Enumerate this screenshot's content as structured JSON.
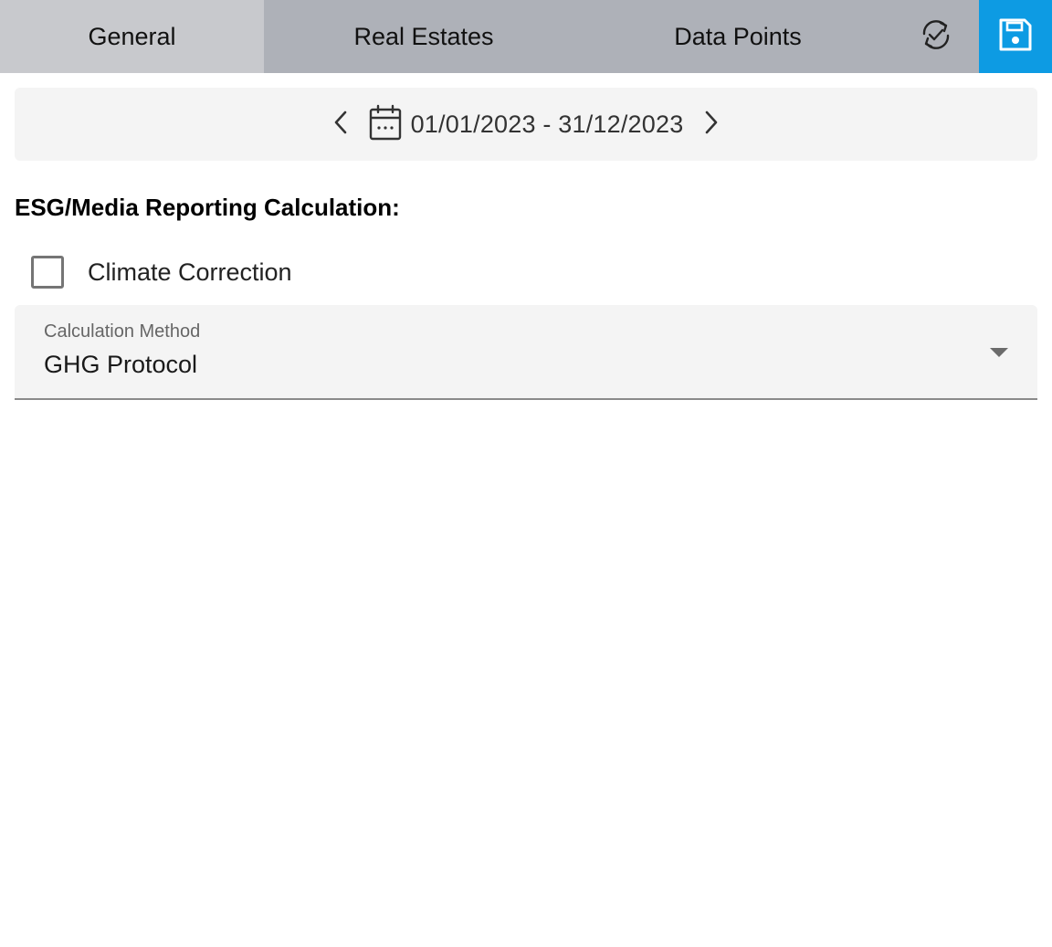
{
  "tabs": {
    "general": "General",
    "real_estates": "Real Estates",
    "data_points": "Data Points"
  },
  "toolbar": {
    "sync_icon": "sync-check-icon",
    "save_icon": "save-icon",
    "save_color": "#0d9be3"
  },
  "date_range": {
    "value": "01/01/2023 - 31/12/2023",
    "prev_icon": "chevron-left-icon",
    "next_icon": "chevron-right-icon",
    "calendar_icon": "calendar-icon"
  },
  "section": {
    "title": "ESG/Media Reporting Calculation:"
  },
  "climate_correction": {
    "label": "Climate Correction",
    "checked": false
  },
  "calculation_method": {
    "label": "Calculation Method",
    "value": "GHG Protocol"
  }
}
